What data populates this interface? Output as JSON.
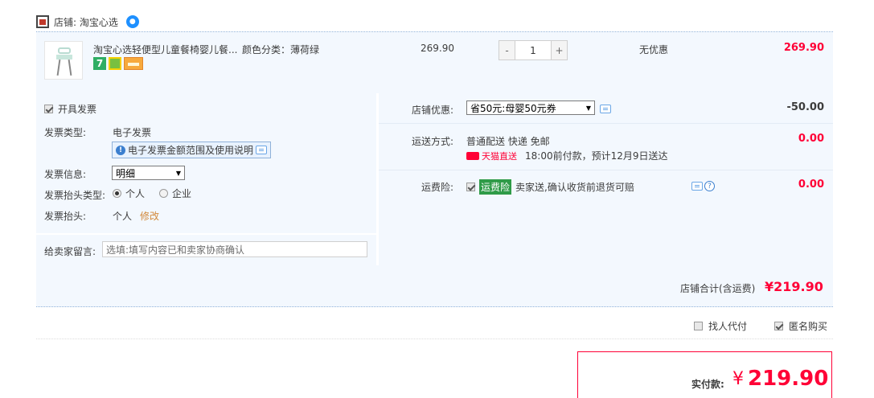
{
  "shop": {
    "label": "店铺: 淘宝心选",
    "ww_icon": "wangwang-icon"
  },
  "item": {
    "title": "淘宝心选轻便型儿童餐椅婴儿餐...",
    "sku": "颜色分类：薄荷绿",
    "unit_price": "269.90",
    "quantity": "1",
    "qty_minus": "-",
    "qty_plus": "+",
    "promo": "无优惠",
    "total": "269.90",
    "badge_7": "7"
  },
  "invoice": {
    "check_label": "开具发票",
    "type_label": "发票类型:",
    "type_value": "电子发票",
    "tip": "电子发票金额范围及使用说明",
    "info_label": "发票信息:",
    "info_value": "明细",
    "head_type_label": "发票抬头类型:",
    "head_type_options": [
      "个人",
      "企业"
    ],
    "head_label": "发票抬头:",
    "head_value": "个人",
    "modify": "修改"
  },
  "message": {
    "label": "给卖家留言:",
    "placeholder": "选填:填写内容已和卖家协商确认"
  },
  "discount": {
    "label": "店铺优惠:",
    "selected": "省50元:母婴50元券",
    "value": "-50.00"
  },
  "shipping": {
    "label": "运送方式:",
    "method": "普通配送 快递 免邮",
    "tag": "天猫直送",
    "eta": "18:00前付款，预计12月9日送达",
    "value": "0.00"
  },
  "insurance": {
    "label": "运费险:",
    "tag": "运费险",
    "desc": "卖家送,确认收货前退货可赔",
    "value": "0.00"
  },
  "subtotal": {
    "label": "店铺合计(含运费)",
    "value": "¥219.90"
  },
  "options": {
    "pay_for_me": "找人代付",
    "anonymous": "匿名购买"
  },
  "payment": {
    "label": "实付款:",
    "currency": "¥",
    "value": "219.90"
  },
  "colors": {
    "accent": "#ff0036",
    "panel_bg": "#f3f8fe",
    "border_blue": "#8fb1d9"
  }
}
